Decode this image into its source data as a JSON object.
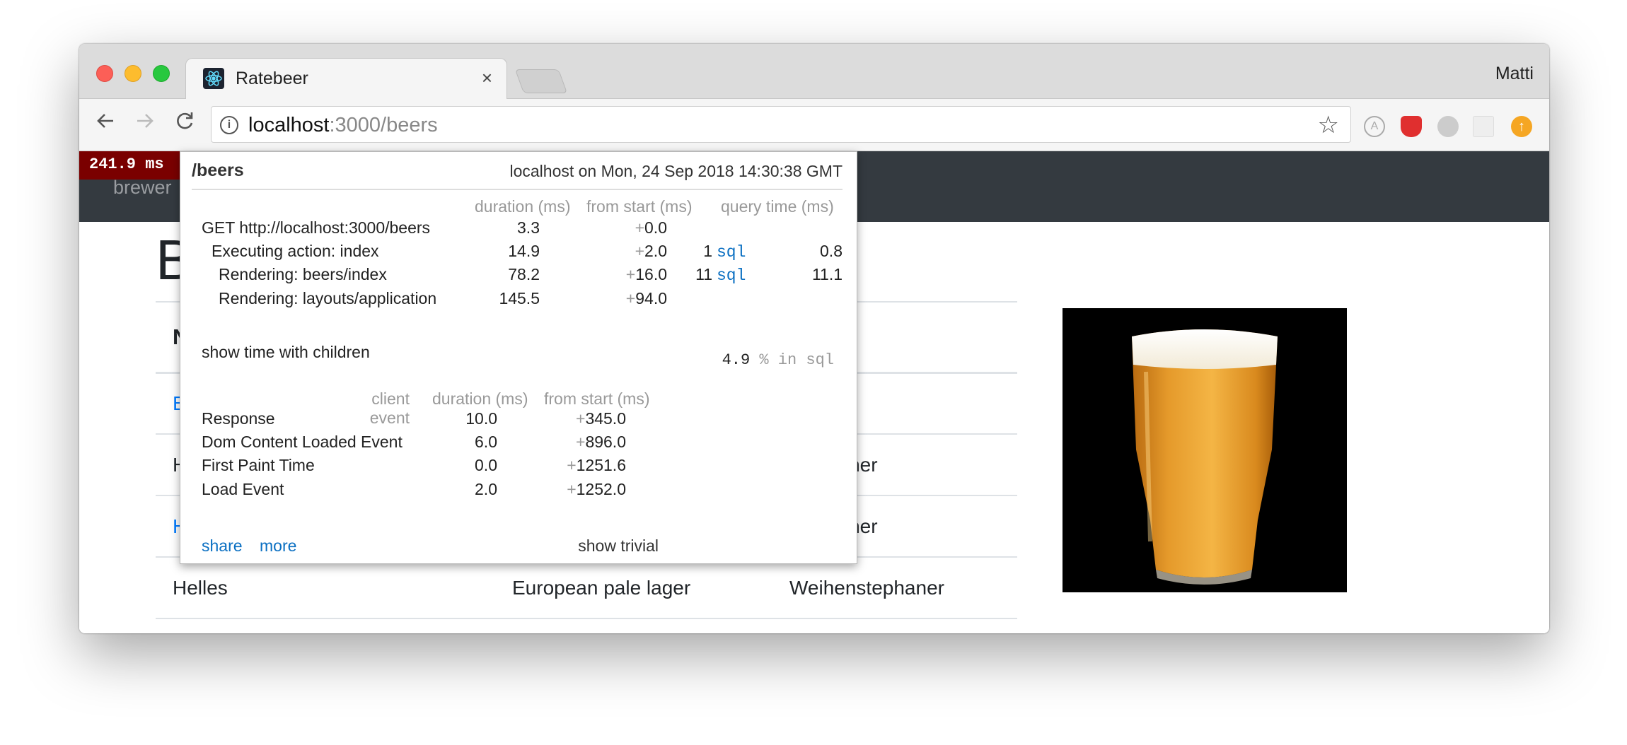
{
  "browser": {
    "tab_title": "Ratebeer",
    "tab_close": "×",
    "user_name": "Matti",
    "url_host": "localhost",
    "url_rest": ":3000/beers"
  },
  "page": {
    "brand_fragment": "brewer",
    "heading_fragment": "B",
    "table": {
      "header_fragments": [
        "N",
        "",
        "ry"
      ],
      "rows": [
        {
          "name": "B",
          "style": "",
          "brewery": "",
          "name_is_link": true
        },
        {
          "name": "H",
          "style": "",
          "brewery": "stephaner",
          "name_is_link": false
        },
        {
          "name": "H",
          "style": "",
          "brewery": "stephaner",
          "name_is_link": true
        },
        {
          "name": "Helles",
          "style": "European pale lager",
          "brewery": "Weihenstephaner",
          "name_is_link": false
        }
      ]
    }
  },
  "profiler": {
    "badge": "241.9 ms",
    "path": "/beers",
    "timestamp": "localhost on Mon, 24 Sep 2018 14:30:38 GMT",
    "server_headers": {
      "duration": "duration (ms)",
      "from_start": "from start (ms)",
      "query_time": "query time (ms)"
    },
    "server_rows": [
      {
        "label": "GET http://localhost:3000/beers",
        "duration": "3.3",
        "from_start": "0.0",
        "sql_count": "",
        "sql_label": "",
        "query_time": ""
      },
      {
        "label": "Executing action: index",
        "duration": "14.9",
        "from_start": "2.0",
        "sql_count": "1",
        "sql_label": "sql",
        "query_time": "0.8"
      },
      {
        "label": "Rendering: beers/index",
        "duration": "78.2",
        "from_start": "16.0",
        "sql_count": "11",
        "sql_label": "sql",
        "query_time": "11.1"
      },
      {
        "label": "Rendering: layouts/application",
        "duration": "145.5",
        "from_start": "94.0",
        "sql_count": "",
        "sql_label": "",
        "query_time": ""
      }
    ],
    "show_children": "show time with children",
    "sql_pct": "4.9",
    "sql_pct_suffix": "% in sql",
    "client_headers": {
      "event": "client event",
      "duration": "duration (ms)",
      "from_start": "from start (ms)"
    },
    "client_rows": [
      {
        "label": "Response",
        "duration": "10.0",
        "from_start": "345.0"
      },
      {
        "label": "Dom Content Loaded Event",
        "duration": "6.0",
        "from_start": "896.0"
      },
      {
        "label": "First Paint Time",
        "duration": "0.0",
        "from_start": "1251.6"
      },
      {
        "label": "Load Event",
        "duration": "2.0",
        "from_start": "1252.0"
      }
    ],
    "plus_sign": "+",
    "share_label": "share",
    "more_label": "more",
    "trivial_label": "show trivial"
  },
  "colors": {
    "navbar": "#343a40",
    "badge": "#7a0000",
    "link": "#0a6fc2"
  },
  "icons": [
    "react-icon",
    "info-icon",
    "star-icon",
    "back-arrow-icon",
    "forward-arrow-icon",
    "reload-icon"
  ]
}
